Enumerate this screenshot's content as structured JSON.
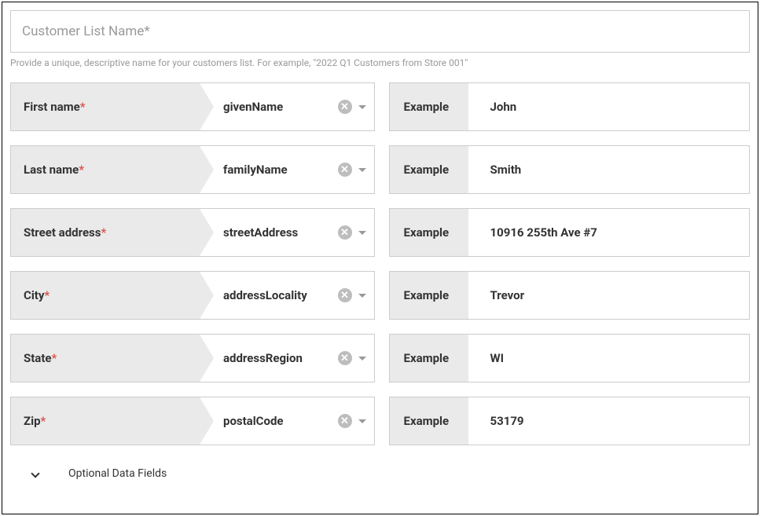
{
  "name_placeholder": "Customer List Name*",
  "hint": "Provide a unique, descriptive name for your customers list. For example, \"2022 Q1 Customers from Store 001\"",
  "example_label": "Example",
  "fields": [
    {
      "label": "First name",
      "required": true,
      "mapping": "givenName",
      "example": "John"
    },
    {
      "label": "Last name",
      "required": true,
      "mapping": "familyName",
      "example": "Smith"
    },
    {
      "label": "Street address",
      "required": true,
      "mapping": "streetAddress",
      "example": "10916 255th Ave #7"
    },
    {
      "label": "City",
      "required": true,
      "mapping": "addressLocality",
      "example": "Trevor"
    },
    {
      "label": "State",
      "required": true,
      "mapping": "addressRegion",
      "example": "WI"
    },
    {
      "label": "Zip",
      "required": true,
      "mapping": "postalCode",
      "example": "53179"
    }
  ],
  "optional_section": "Optional Data Fields"
}
